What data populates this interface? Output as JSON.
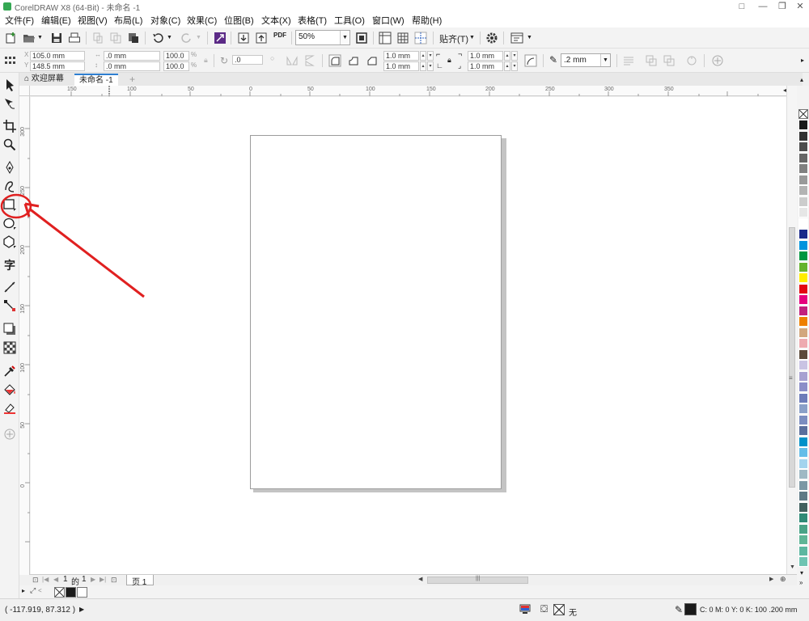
{
  "window": {
    "title": "CorelDRAW X8 (64-Bit) - 未命名 -1",
    "controls": [
      "□",
      "—",
      "❐",
      "✕"
    ]
  },
  "menu": {
    "items": [
      "文件(F)",
      "编辑(E)",
      "视图(V)",
      "布局(L)",
      "对象(C)",
      "效果(C)",
      "位图(B)",
      "文本(X)",
      "表格(T)",
      "工具(O)",
      "窗口(W)",
      "帮助(H)"
    ]
  },
  "toolbar": {
    "zoom_value": "50%",
    "pdf_label": "PDF",
    "snap_label": "贴齐(T)"
  },
  "propbar": {
    "width": "105.0 mm",
    "height": "148.5 mm",
    "pos_x": ".0 mm",
    "pos_y": ".0 mm",
    "scale_x": "100.0",
    "scale_y": "100.0",
    "pct": "%",
    "rotation": ".0",
    "corner1": "1.0 mm",
    "corner2": "1.0 mm",
    "corner3": "1.0 mm",
    "corner4": "1.0 mm",
    "outline_width": ".2 mm"
  },
  "tabs": {
    "welcome": "欢迎屏幕",
    "document": "未命名 -1",
    "add": "+"
  },
  "ruler": {
    "top": [
      "150",
      "100",
      "50",
      "0",
      "50",
      "100",
      "150",
      "200",
      "250",
      "300",
      "350"
    ],
    "left": [
      "300",
      "250",
      "200",
      "150",
      "100",
      "50",
      "0"
    ]
  },
  "pagenav": {
    "current": "1",
    "of": "的",
    "total": "1",
    "page_tab": "页 1"
  },
  "palette": {
    "colors": [
      "#1a1a1a",
      "#333333",
      "#4d4d4d",
      "#666666",
      "#808080",
      "#999999",
      "#b3b3b3",
      "#cccccc",
      "#e6e6e6",
      "#ffffff",
      "#1b2a8a",
      "#0093dd",
      "#00963f",
      "#66b32e",
      "#ffed00",
      "#e30613",
      "#e5007d",
      "#c2207d",
      "#ee7f00",
      "#d2a77e",
      "#eeaab0",
      "#5c4a3a",
      "#c9c3e3",
      "#a7a1d1",
      "#8b8ec8",
      "#6d7cb9",
      "#8aa0c8",
      "#7b8dc0",
      "#596e9d",
      "#0090c9",
      "#66bde8",
      "#a3d4ee",
      "#9fb9c4",
      "#7b97a4",
      "#5f7a86",
      "#41605e",
      "#2f8a76",
      "#4aa387",
      "#5fb596",
      "#5db7a0",
      "#6fc4b2"
    ]
  },
  "status": {
    "coords": "( -117.919, 87.312 )",
    "fill_none": "无",
    "outline_info": "C: 0 M: 0 Y: 0 K: 100  .200 mm"
  }
}
